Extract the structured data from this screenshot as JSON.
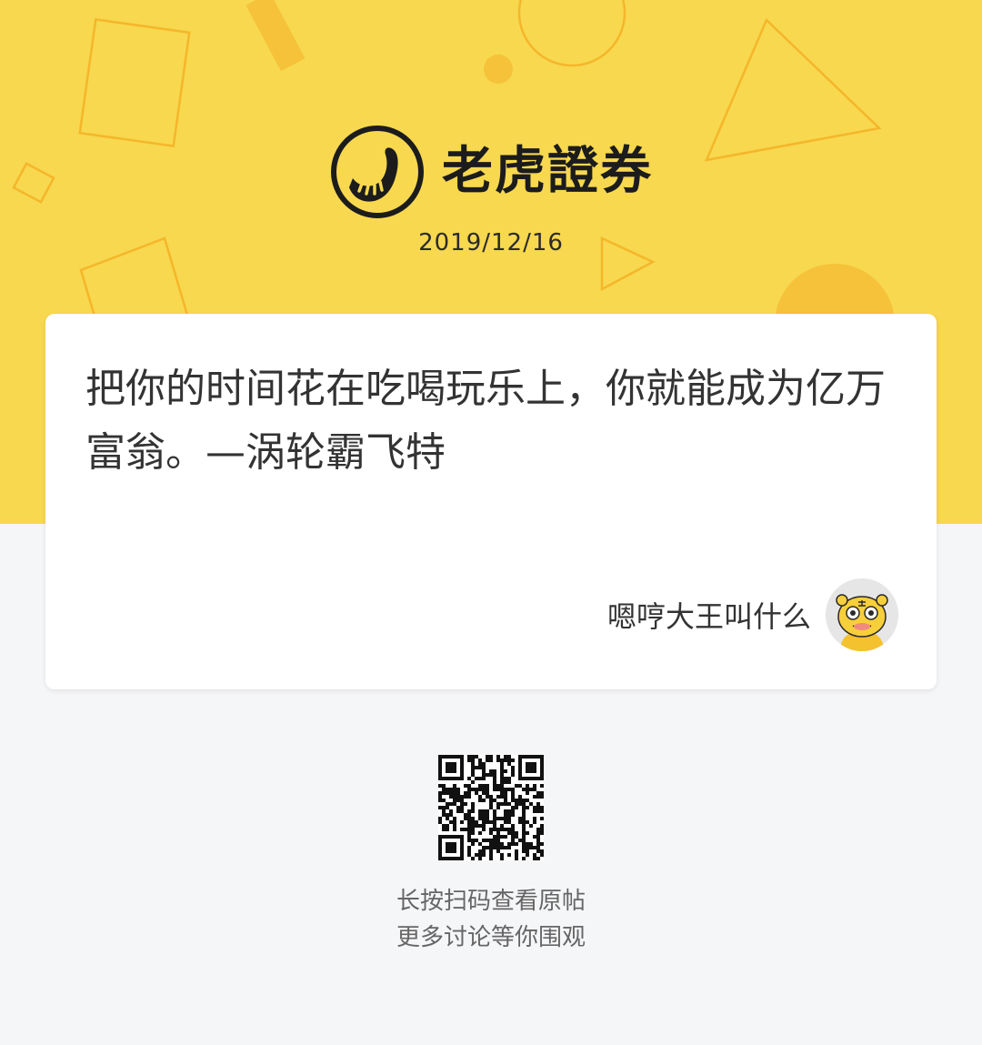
{
  "header": {
    "brand_name": "老虎證券",
    "date": "2019/12/16",
    "background_color": "#f7d84f",
    "logo_icon": "tiger-tail-logo-icon"
  },
  "post": {
    "quote": "把你的时间花在吃喝玩乐上，你就能成为亿万富翁。—涡轮霸飞特",
    "author_name": "嗯哼大王叫什么",
    "avatar_icon": "tiger-avatar-icon"
  },
  "footer": {
    "qr_icon": "qr-code-icon",
    "hint_line1": "长按扫码查看原帖",
    "hint_line2": "更多讨论等你围观"
  }
}
